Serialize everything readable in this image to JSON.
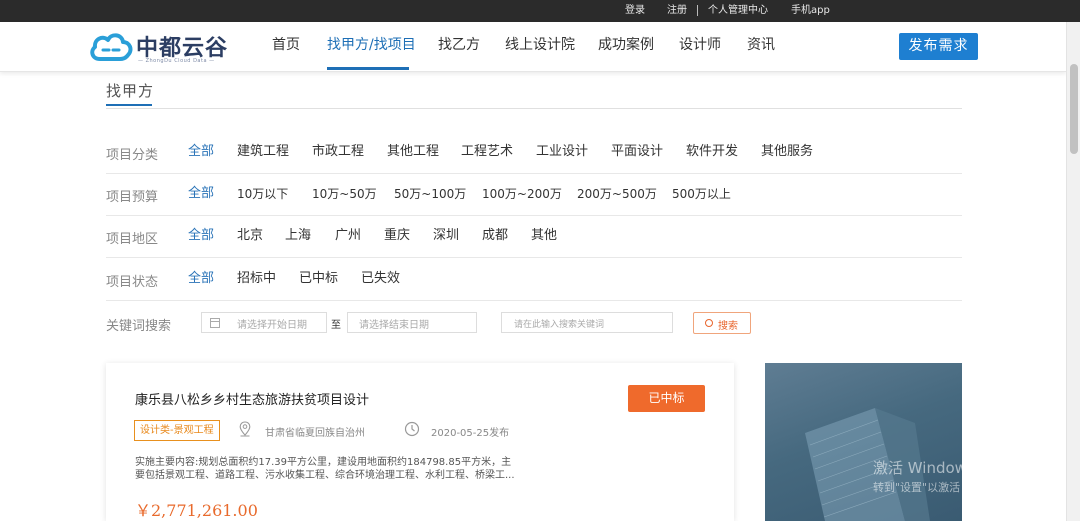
{
  "topbar": {
    "login": "登录",
    "register": "注册",
    "user_center": "个人管理中心",
    "mobile_app": "手机app"
  },
  "header": {
    "logo_text": "中都云谷",
    "logo_sub": "— ZhongDu Cloud Data —",
    "nav": [
      "首页",
      "找甲方/找项目",
      "找乙方",
      "线上设计院",
      "成功案例",
      "设计师",
      "资讯"
    ],
    "active_nav": "找甲方/找项目",
    "publish_button": "发布需求",
    "brand_color": "#1e7fd1"
  },
  "section": {
    "title": "找甲方"
  },
  "filters": {
    "category": {
      "label": "项目分类",
      "options": [
        "全部",
        "建筑工程",
        "市政工程",
        "其他工程",
        "工程艺术",
        "工业设计",
        "平面设计",
        "软件开发",
        "其他服务"
      ],
      "selected": "全部"
    },
    "budget": {
      "label": "项目预算",
      "options": [
        "全部",
        "10万以下",
        "10万~50万",
        "50万~100万",
        "100万~200万",
        "200万~500万",
        "500万以上"
      ],
      "selected": "全部"
    },
    "region": {
      "label": "项目地区",
      "options": [
        "全部",
        "北京",
        "上海",
        "广州",
        "重庆",
        "深圳",
        "成都",
        "其他"
      ],
      "selected": "全部"
    },
    "status": {
      "label": "项目状态",
      "options": [
        "全部",
        "招标中",
        "已中标",
        "已失效"
      ],
      "selected": "全部"
    },
    "keyword": {
      "label": "关键词搜索",
      "start_date_placeholder": "请选择开始日期",
      "to": "至",
      "end_date_placeholder": "请选择结束日期",
      "keyword_placeholder": "请在此输入搜索关键词",
      "search_button": "搜索"
    }
  },
  "project": {
    "title": "康乐县八松乡乡村生态旅游扶贫项目设计",
    "status": "已中标",
    "tag": "设计类-景观工程",
    "location": "甘肃省临夏回族自治州",
    "date": "2020-05-25发布",
    "description": "实施主要内容:规划总面积约17.39平方公里，建设用地面积约184798.85平方米，主要包括景观工程、道路工程、污水收集工程、综合环境治理工程、水利工程、桥梁工...",
    "price": "￥2,771,261.00",
    "accent_color": "#ef6a2c"
  },
  "os_watermark": {
    "line1": "激活 Windows",
    "line2": "转到\"设置\"以激活 Windows。"
  }
}
